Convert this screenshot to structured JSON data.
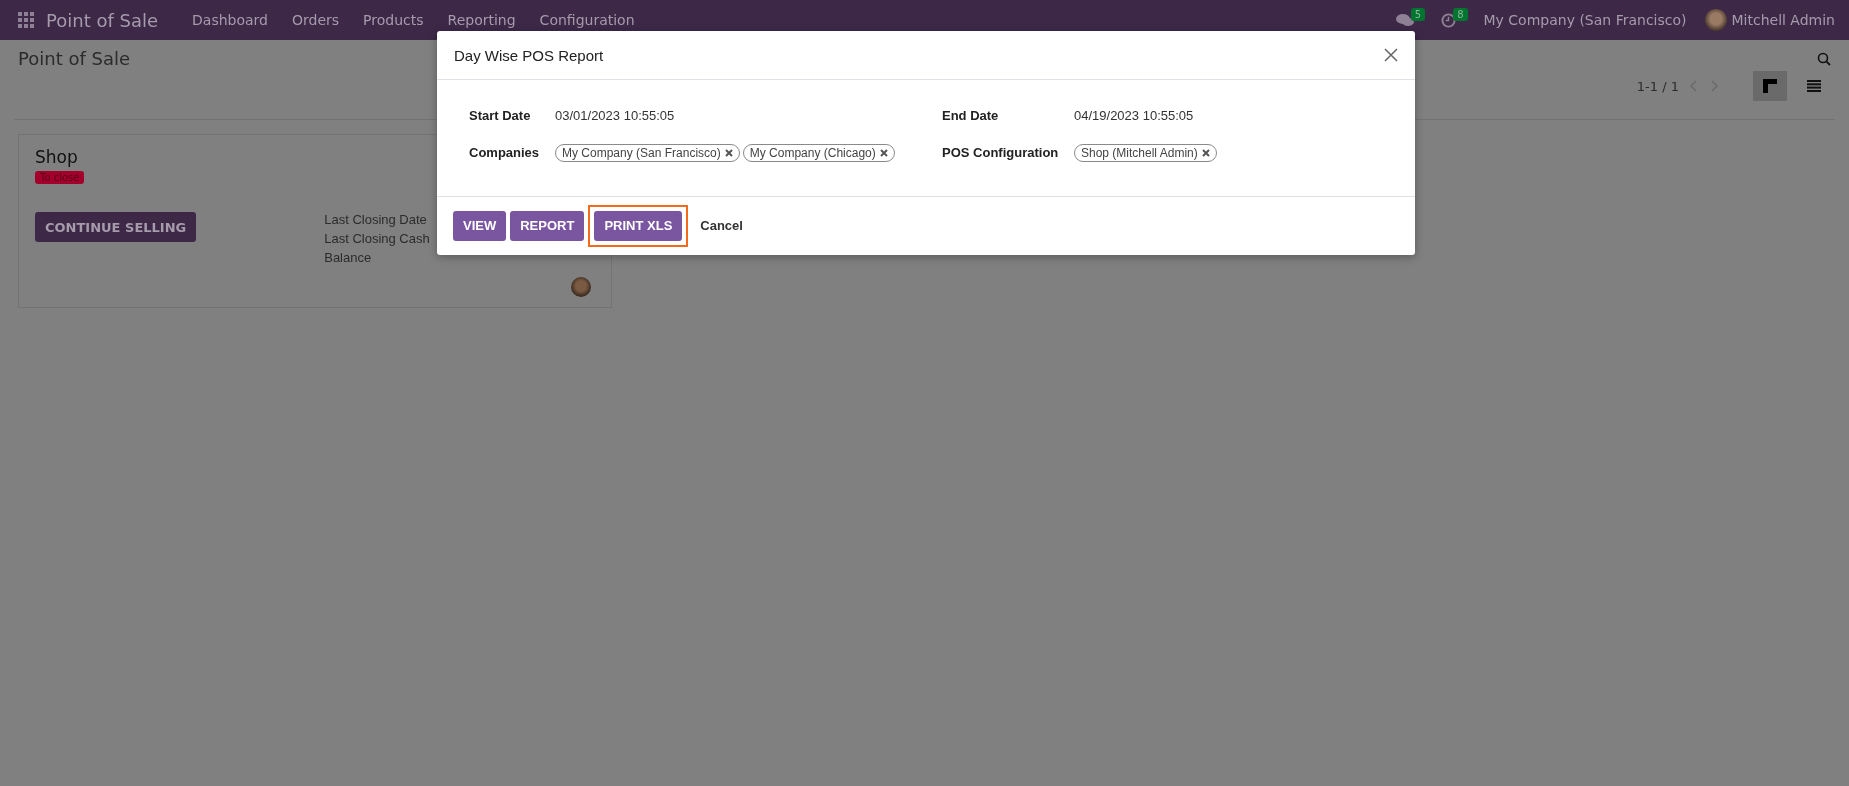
{
  "navbar": {
    "app_name": "Point of Sale",
    "menu": [
      "Dashboard",
      "Orders",
      "Products",
      "Reporting",
      "Configuration"
    ],
    "messages_count": "5",
    "activities_count": "8",
    "company": "My Company (San Francisco)",
    "user": "Mitchell Admin"
  },
  "control_panel": {
    "title": "Point of Sale",
    "pager": "1-1 / 1",
    "views": [
      {
        "kind": "kanban",
        "selected": true
      },
      {
        "kind": "list",
        "selected": false
      }
    ]
  },
  "cards": [
    {
      "title": "Shop",
      "status": "To close",
      "button": "CONTINUE SELLING",
      "fields": [
        "Last Closing Date",
        "Last Closing Cash",
        "Balance"
      ]
    }
  ],
  "dialog": {
    "title": "Day Wise POS Report",
    "fields": [
      {
        "label": "Start Date",
        "kind": "text",
        "value": "03/01/2023 10:55:05"
      },
      {
        "label": "End Date",
        "kind": "text",
        "value": "04/19/2023 10:55:05"
      },
      {
        "label": "Companies",
        "kind": "tags",
        "tags": [
          "My Company (San Francisco)",
          "My Company (Chicago)"
        ]
      },
      {
        "label": "POS Configuration",
        "kind": "tags",
        "tags": [
          "Shop (Mitchell Admin)"
        ]
      }
    ],
    "buttons": [
      {
        "label": "VIEW",
        "kind": "primary",
        "highlighted": false
      },
      {
        "label": "REPORT",
        "kind": "primary",
        "highlighted": false
      },
      {
        "label": "PRINT XLS",
        "kind": "primary",
        "highlighted": true
      },
      {
        "label": "Cancel",
        "kind": "link",
        "highlighted": false
      }
    ]
  }
}
